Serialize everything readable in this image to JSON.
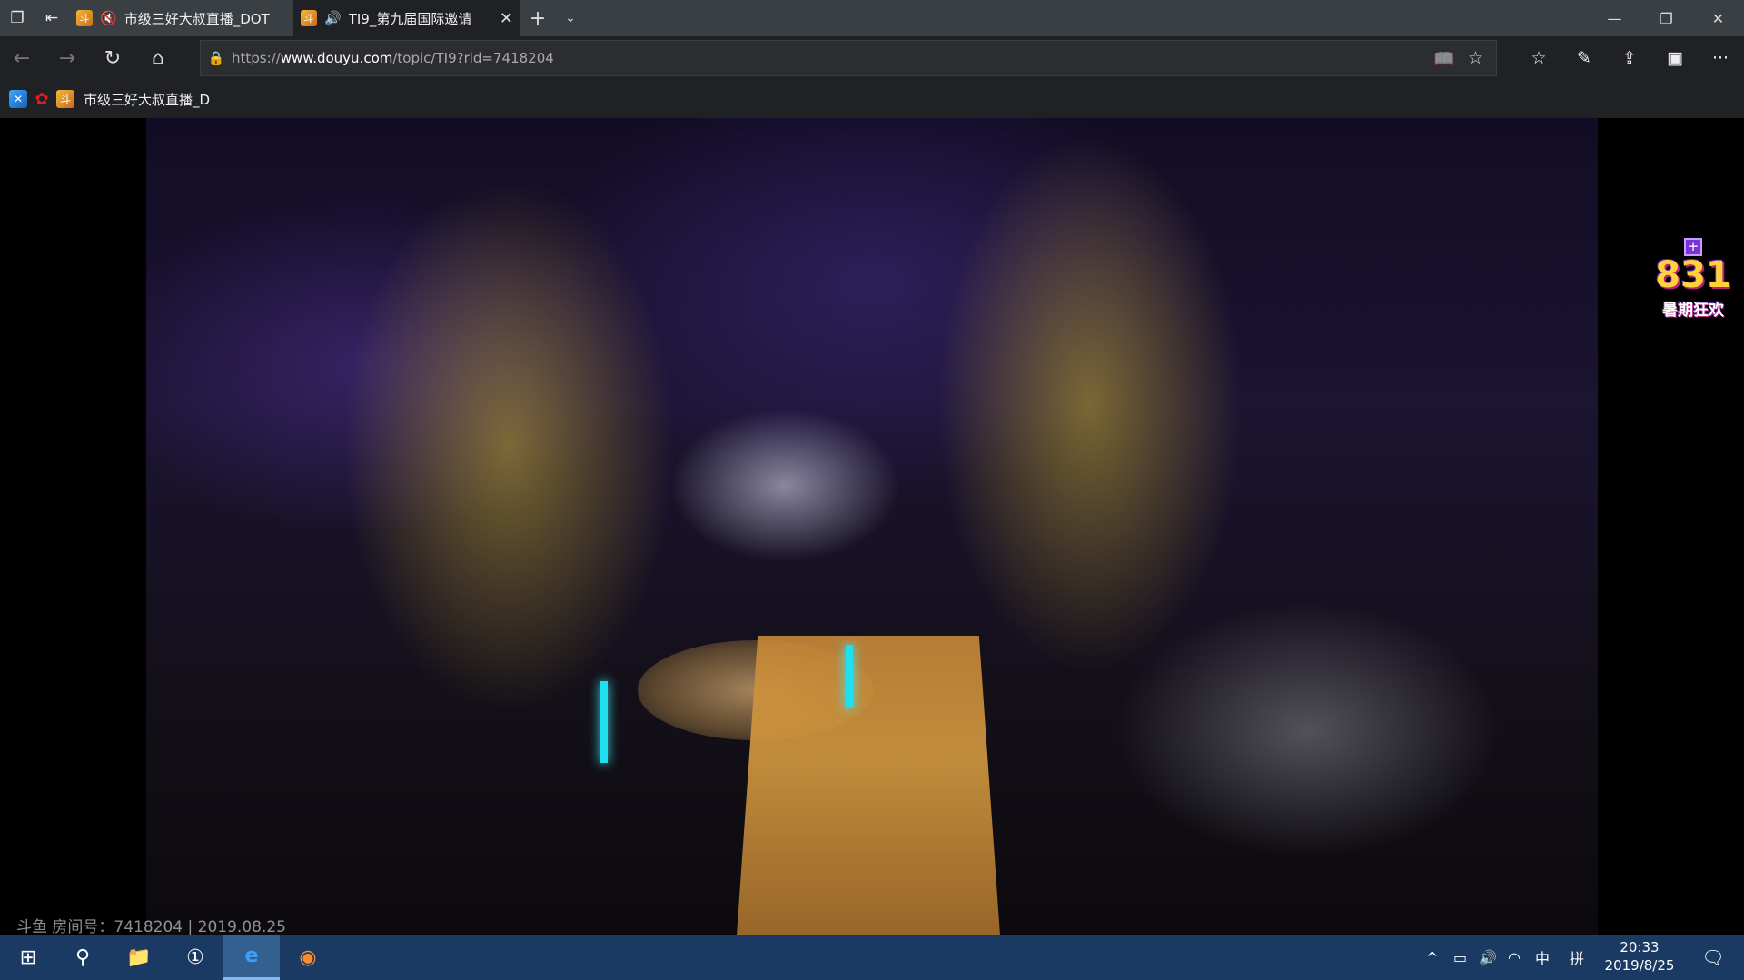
{
  "browser": {
    "tabs": [
      {
        "title": "市级三好大叔直播_DOT",
        "audio_icon": "muted-speaker-icon",
        "close_label": ""
      },
      {
        "title": "TI9_第九届国际邀请",
        "audio_icon": "speaker-icon",
        "close_label": "✕"
      }
    ],
    "new_tab": "+",
    "tab_list": "⌄",
    "window_controls": [
      "—",
      "❐",
      "✕"
    ],
    "nav": {
      "back": "←",
      "forward": "→",
      "refresh": "↻",
      "home": "⌂"
    },
    "address": {
      "url_prefix": "https://",
      "url_host": "www.douyu.com",
      "url_path": "/topic/TI9?rid=7418204",
      "lock": "🔒"
    },
    "address_icons": {
      "reading_view": "📖",
      "favorite": "☆"
    },
    "toolbar": {
      "favorites": "☆",
      "notes": "✎",
      "share": "⇪",
      "extensions": "▣",
      "more": "···"
    },
    "favorites_bar": [
      {
        "icon": "app-icon-blue",
        "label": ""
      },
      {
        "icon": "red-flower-icon",
        "label": ""
      },
      {
        "icon": "douyu-icon",
        "label": "市级三好大叔直播_D("
      }
    ]
  },
  "video": {
    "promo_plus": "+",
    "promo_number": "831",
    "promo_text": "暑期狂欢",
    "watermark": "斗鱼 房间号：7418204 | 2019.08.25"
  },
  "taskbar": {
    "start": "⊞",
    "search": "⚲",
    "apps": [
      {
        "name": "file-explorer-icon",
        "glyph": "📁"
      },
      {
        "name": "password-manager-icon",
        "glyph": "①"
      },
      {
        "name": "edge-icon",
        "glyph": "e"
      },
      {
        "name": "firefox-icon",
        "glyph": "◉"
      }
    ],
    "tray": {
      "chevron": "^",
      "battery": "▭",
      "volume": "🔊",
      "network": "◠",
      "ime": "中",
      "ime_mode": "拼"
    },
    "time": "20:33",
    "date": "2019/8/25",
    "notification": "🗨"
  }
}
